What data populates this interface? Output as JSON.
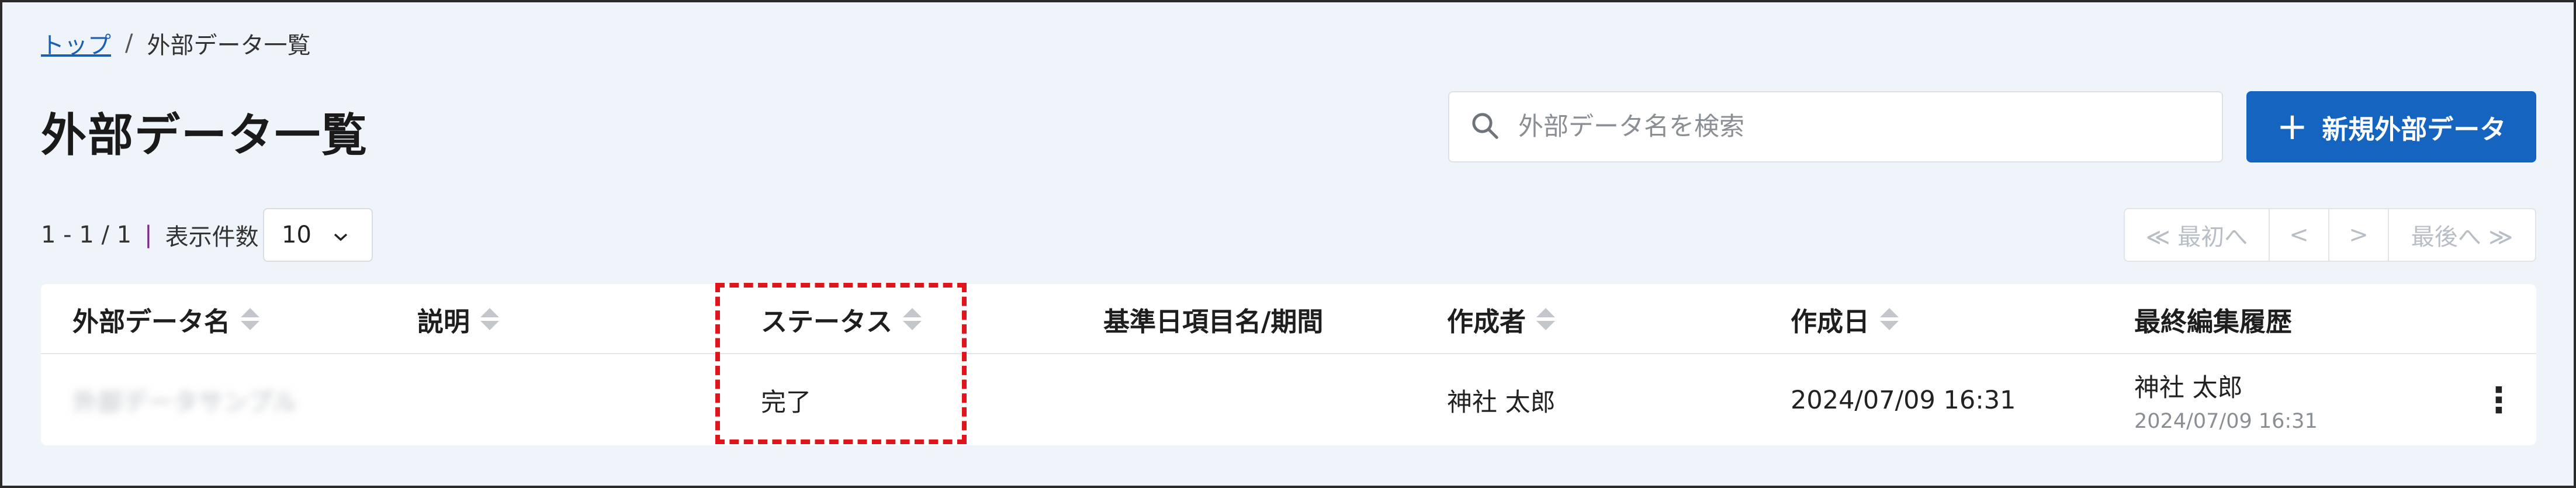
{
  "breadcrumb": {
    "home": "トップ",
    "separator": "/",
    "current": "外部データ一覧"
  },
  "page_title": "外部データ一覧",
  "search": {
    "placeholder": "外部データ名を検索",
    "icon": "search-icon"
  },
  "new_button": {
    "plus": "+",
    "label": "新規外部データ"
  },
  "paging": {
    "range": "1 - 1 / 1",
    "bar": "|",
    "page_size_label": "表示件数",
    "page_size_value": "10",
    "first": "≪ 最初へ",
    "prev": "<",
    "next": ">",
    "last": "最後へ ≫"
  },
  "table": {
    "headers": [
      "外部データ名",
      "説明",
      "ステータス",
      "基準日項目名/期間",
      "作成者",
      "作成日",
      "最終編集履歴"
    ],
    "rows": [
      {
        "name": "外部データサンプル",
        "description": "",
        "status": "完了",
        "base_date": "",
        "creator": "神社 太郎",
        "created": "2024/07/09 16:31",
        "last_edit_user": "神社 太郎",
        "last_edit_time": "2024/07/09 16:31",
        "menu": "⋮"
      }
    ]
  },
  "colors": {
    "primary": "#1565c0",
    "background": "#eff4fb",
    "highlight": "#e0151c"
  }
}
